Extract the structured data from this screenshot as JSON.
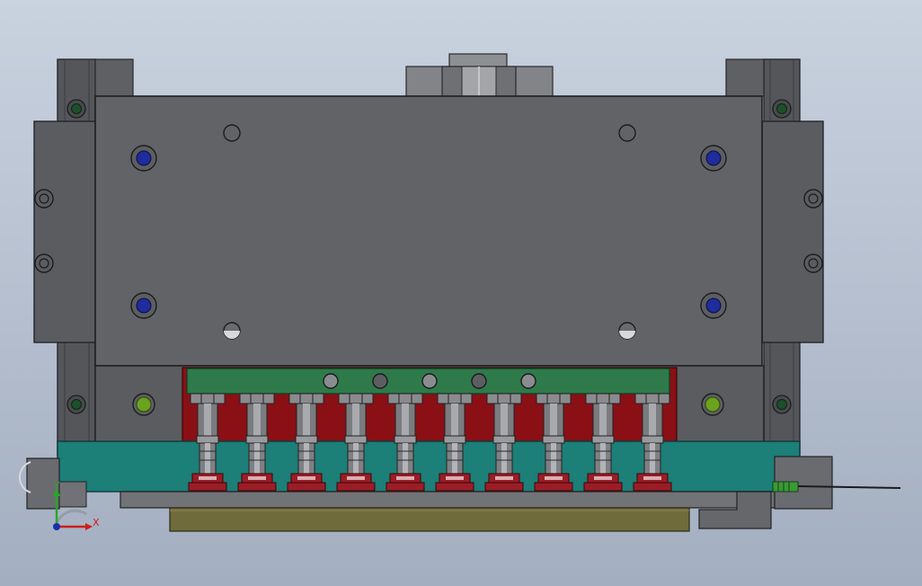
{
  "view": {
    "background_top": "#c9d2df",
    "background_bottom": "#a3aec0"
  },
  "colors": {
    "housing": "#5b5c5f",
    "plate_main": "#626366",
    "rail": "#55565a",
    "green_bar": "#2e7a4a",
    "red_back": "#8a1016",
    "teal_base": "#1c7f78",
    "pad": "#9b1d26",
    "olive_strip": "#6f6b3a",
    "bolt_blue": "#1e2c9c",
    "bolt_green": "#6aa31e",
    "hole_dark_green": "#1d4f2a"
  },
  "nozzles": {
    "count": 10
  },
  "triad": {
    "x_label": "X",
    "y_label": "Y",
    "x_color": "#d11b1b",
    "y_color": "#2aa526",
    "z_color": "#1a2fb0"
  }
}
